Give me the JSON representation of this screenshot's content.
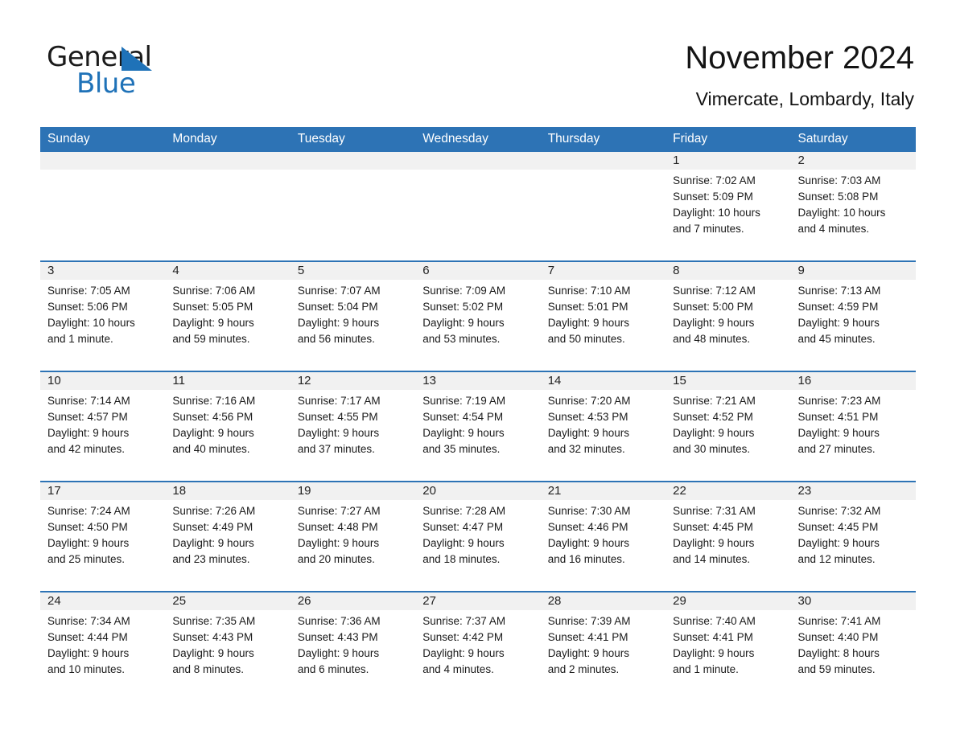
{
  "brand": {
    "name_part1": "General",
    "name_part2": "Blue",
    "accent_color": "#1f72b8"
  },
  "header": {
    "title": "November 2024",
    "subtitle": "Vimercate, Lombardy, Italy"
  },
  "theme": {
    "header_blue": "#2d73b5",
    "datebar_gray": "#f1f1f1",
    "text_color": "#1a1a1a"
  },
  "weekdays": [
    "Sunday",
    "Monday",
    "Tuesday",
    "Wednesday",
    "Thursday",
    "Friday",
    "Saturday"
  ],
  "weeks": [
    {
      "days": [
        {
          "num": "",
          "lines": [
            "",
            "",
            "",
            ""
          ]
        },
        {
          "num": "",
          "lines": [
            "",
            "",
            "",
            ""
          ]
        },
        {
          "num": "",
          "lines": [
            "",
            "",
            "",
            ""
          ]
        },
        {
          "num": "",
          "lines": [
            "",
            "",
            "",
            ""
          ]
        },
        {
          "num": "",
          "lines": [
            "",
            "",
            "",
            ""
          ]
        },
        {
          "num": "1",
          "lines": [
            "Sunrise: 7:02 AM",
            "Sunset: 5:09 PM",
            "Daylight: 10 hours",
            "and 7 minutes."
          ]
        },
        {
          "num": "2",
          "lines": [
            "Sunrise: 7:03 AM",
            "Sunset: 5:08 PM",
            "Daylight: 10 hours",
            "and 4 minutes."
          ]
        }
      ]
    },
    {
      "days": [
        {
          "num": "3",
          "lines": [
            "Sunrise: 7:05 AM",
            "Sunset: 5:06 PM",
            "Daylight: 10 hours",
            "and 1 minute."
          ]
        },
        {
          "num": "4",
          "lines": [
            "Sunrise: 7:06 AM",
            "Sunset: 5:05 PM",
            "Daylight: 9 hours",
            "and 59 minutes."
          ]
        },
        {
          "num": "5",
          "lines": [
            "Sunrise: 7:07 AM",
            "Sunset: 5:04 PM",
            "Daylight: 9 hours",
            "and 56 minutes."
          ]
        },
        {
          "num": "6",
          "lines": [
            "Sunrise: 7:09 AM",
            "Sunset: 5:02 PM",
            "Daylight: 9 hours",
            "and 53 minutes."
          ]
        },
        {
          "num": "7",
          "lines": [
            "Sunrise: 7:10 AM",
            "Sunset: 5:01 PM",
            "Daylight: 9 hours",
            "and 50 minutes."
          ]
        },
        {
          "num": "8",
          "lines": [
            "Sunrise: 7:12 AM",
            "Sunset: 5:00 PM",
            "Daylight: 9 hours",
            "and 48 minutes."
          ]
        },
        {
          "num": "9",
          "lines": [
            "Sunrise: 7:13 AM",
            "Sunset: 4:59 PM",
            "Daylight: 9 hours",
            "and 45 minutes."
          ]
        }
      ]
    },
    {
      "days": [
        {
          "num": "10",
          "lines": [
            "Sunrise: 7:14 AM",
            "Sunset: 4:57 PM",
            "Daylight: 9 hours",
            "and 42 minutes."
          ]
        },
        {
          "num": "11",
          "lines": [
            "Sunrise: 7:16 AM",
            "Sunset: 4:56 PM",
            "Daylight: 9 hours",
            "and 40 minutes."
          ]
        },
        {
          "num": "12",
          "lines": [
            "Sunrise: 7:17 AM",
            "Sunset: 4:55 PM",
            "Daylight: 9 hours",
            "and 37 minutes."
          ]
        },
        {
          "num": "13",
          "lines": [
            "Sunrise: 7:19 AM",
            "Sunset: 4:54 PM",
            "Daylight: 9 hours",
            "and 35 minutes."
          ]
        },
        {
          "num": "14",
          "lines": [
            "Sunrise: 7:20 AM",
            "Sunset: 4:53 PM",
            "Daylight: 9 hours",
            "and 32 minutes."
          ]
        },
        {
          "num": "15",
          "lines": [
            "Sunrise: 7:21 AM",
            "Sunset: 4:52 PM",
            "Daylight: 9 hours",
            "and 30 minutes."
          ]
        },
        {
          "num": "16",
          "lines": [
            "Sunrise: 7:23 AM",
            "Sunset: 4:51 PM",
            "Daylight: 9 hours",
            "and 27 minutes."
          ]
        }
      ]
    },
    {
      "days": [
        {
          "num": "17",
          "lines": [
            "Sunrise: 7:24 AM",
            "Sunset: 4:50 PM",
            "Daylight: 9 hours",
            "and 25 minutes."
          ]
        },
        {
          "num": "18",
          "lines": [
            "Sunrise: 7:26 AM",
            "Sunset: 4:49 PM",
            "Daylight: 9 hours",
            "and 23 minutes."
          ]
        },
        {
          "num": "19",
          "lines": [
            "Sunrise: 7:27 AM",
            "Sunset: 4:48 PM",
            "Daylight: 9 hours",
            "and 20 minutes."
          ]
        },
        {
          "num": "20",
          "lines": [
            "Sunrise: 7:28 AM",
            "Sunset: 4:47 PM",
            "Daylight: 9 hours",
            "and 18 minutes."
          ]
        },
        {
          "num": "21",
          "lines": [
            "Sunrise: 7:30 AM",
            "Sunset: 4:46 PM",
            "Daylight: 9 hours",
            "and 16 minutes."
          ]
        },
        {
          "num": "22",
          "lines": [
            "Sunrise: 7:31 AM",
            "Sunset: 4:45 PM",
            "Daylight: 9 hours",
            "and 14 minutes."
          ]
        },
        {
          "num": "23",
          "lines": [
            "Sunrise: 7:32 AM",
            "Sunset: 4:45 PM",
            "Daylight: 9 hours",
            "and 12 minutes."
          ]
        }
      ]
    },
    {
      "days": [
        {
          "num": "24",
          "lines": [
            "Sunrise: 7:34 AM",
            "Sunset: 4:44 PM",
            "Daylight: 9 hours",
            "and 10 minutes."
          ]
        },
        {
          "num": "25",
          "lines": [
            "Sunrise: 7:35 AM",
            "Sunset: 4:43 PM",
            "Daylight: 9 hours",
            "and 8 minutes."
          ]
        },
        {
          "num": "26",
          "lines": [
            "Sunrise: 7:36 AM",
            "Sunset: 4:43 PM",
            "Daylight: 9 hours",
            "and 6 minutes."
          ]
        },
        {
          "num": "27",
          "lines": [
            "Sunrise: 7:37 AM",
            "Sunset: 4:42 PM",
            "Daylight: 9 hours",
            "and 4 minutes."
          ]
        },
        {
          "num": "28",
          "lines": [
            "Sunrise: 7:39 AM",
            "Sunset: 4:41 PM",
            "Daylight: 9 hours",
            "and 2 minutes."
          ]
        },
        {
          "num": "29",
          "lines": [
            "Sunrise: 7:40 AM",
            "Sunset: 4:41 PM",
            "Daylight: 9 hours",
            "and 1 minute."
          ]
        },
        {
          "num": "30",
          "lines": [
            "Sunrise: 7:41 AM",
            "Sunset: 4:40 PM",
            "Daylight: 8 hours",
            "and 59 minutes."
          ]
        }
      ]
    }
  ]
}
